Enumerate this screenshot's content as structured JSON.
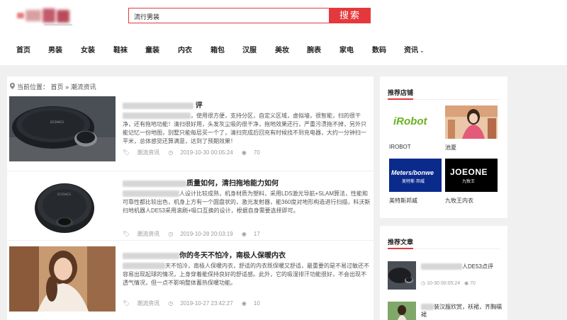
{
  "header": {
    "search_value": "流行男装",
    "search_button": "搜索"
  },
  "nav": {
    "items": [
      "首页",
      "男装",
      "女装",
      "鞋袜",
      "童装",
      "内衣",
      "箱包",
      "汉服",
      "美妆",
      "腕表",
      "家电",
      "数码",
      "资讯"
    ]
  },
  "breadcrumb": {
    "prefix": "当前位置：",
    "home": "首页",
    "sep": "»",
    "current": "潮流资讯"
  },
  "articles": [
    {
      "title": "评",
      "text": "，使用很方便，支持分区，自定义区域，虚拟墙，很智能，扫的很干净，还有拖地功能！清扫很好用，头发灰尘吸的很干净，拖地效果还行，严重污渍拖不掉，另外只能记忆一份地图，别墅只能每层买一个了，清扫完成后回充有时候找不到充电器，大约一分钟扫一平米，总体感觉还算满意，达到了预期效果！",
      "category": "潮流资讯",
      "date": "2019-10-30 00:05:24",
      "views": "70"
    },
    {
      "title": "质量如何，清扫拖地能力如何",
      "text": "人设计比较成熟，机身材质为塑料，采用LDS激光导航+SLAM算法，性能和可靠性都比较出色，机身上方有一个圆盘状的，激光发射器，能360度对地形构造进行扫描，科沃斯扫地机器人DE53采用滚刷+吸口互换的设计，根据自身需要选择即可。",
      "category": "潮流资讯",
      "date": "2019-10-28 20:03:19",
      "views": "17"
    },
    {
      "title": "你的冬天不怕冷，南极人保暖内衣",
      "text": "天不怕冷，南极人保暖内衣，舒适的内衣既保暖又舒适，最重要的是不易过敏还不容易出现起球的情况，上身穿着能保持良好的舒适感。此外，它的吸湿排汗功能很好，不会出现不透气情况，但一点不影响整体蓄热保暖功能。",
      "category": "潮流资讯",
      "date": "2019-10-27 23:42:27",
      "views": "10"
    }
  ],
  "sidebar": {
    "shops_title": "推荐店铺",
    "shops": [
      {
        "name": "IROBOT",
        "logo_text": "iRobot"
      },
      {
        "name": "池夏",
        "logo_text": ""
      },
      {
        "name": "美特斯邦威",
        "logo_text": "Meters/bonwe",
        "logo_sub": "美特斯·邦威"
      },
      {
        "name": "九牧王内衣",
        "logo_text": "JOEONE",
        "logo_sub": "九牧王"
      }
    ],
    "articles_title": "推荐文章",
    "articles": [
      {
        "title": "人DE53点评",
        "date": "10-30 00:05:24",
        "views": "70"
      },
      {
        "title": "装汉服欣赏，袄裙，齐胸襦裙",
        "date": "",
        "views": ""
      }
    ]
  },
  "colors": {
    "accent": "#e4393c",
    "irobot_green": "#6ab023",
    "metersbonwe_blue": "#0a2a8c"
  }
}
